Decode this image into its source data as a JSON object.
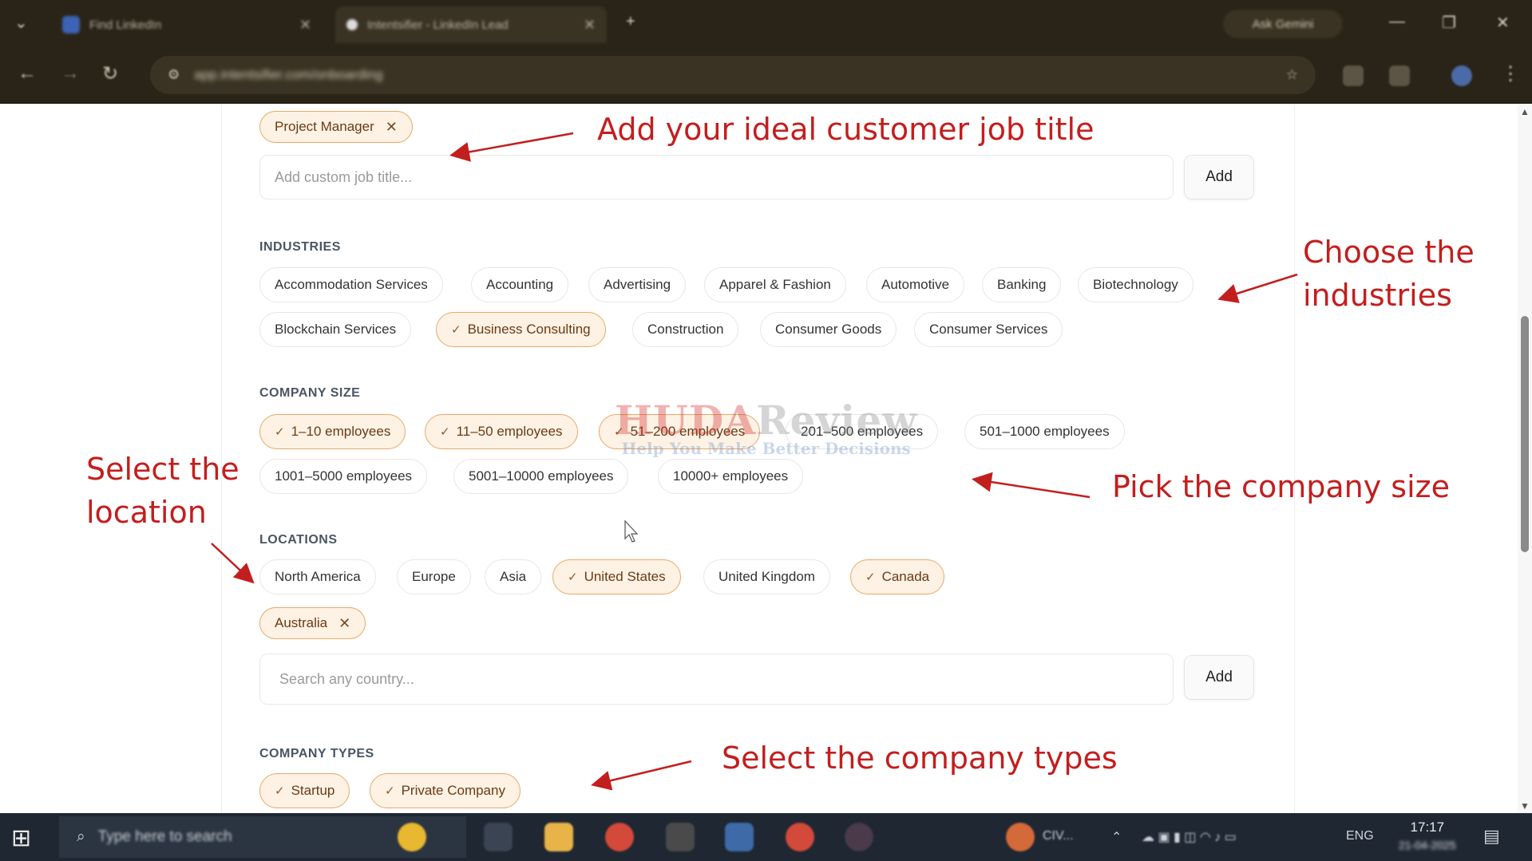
{
  "browser": {
    "tab1_title": "Find LinkedIn",
    "tab2_title": "Intentsifier - LinkedIn Lead",
    "ask_gemini": "Ask Gemini",
    "url": "app.intentsifier.com/onboarding"
  },
  "job_titles": {
    "selected": [
      {
        "label": "Project Manager"
      }
    ],
    "input_placeholder": "Add custom job title...",
    "add_label": "Add"
  },
  "industries": {
    "heading": "INDUSTRIES",
    "options": [
      {
        "label": "Accommodation Services",
        "selected": false
      },
      {
        "label": "Accounting",
        "selected": false
      },
      {
        "label": "Advertising",
        "selected": false
      },
      {
        "label": "Apparel & Fashion",
        "selected": false
      },
      {
        "label": "Automotive",
        "selected": false
      },
      {
        "label": "Banking",
        "selected": false
      },
      {
        "label": "Biotechnology",
        "selected": false
      },
      {
        "label": "Blockchain Services",
        "selected": false
      },
      {
        "label": "Business Consulting",
        "selected": true
      },
      {
        "label": "Construction",
        "selected": false
      },
      {
        "label": "Consumer Goods",
        "selected": false
      },
      {
        "label": "Consumer Services",
        "selected": false
      }
    ]
  },
  "company_size": {
    "heading": "COMPANY SIZE",
    "options": [
      {
        "label": "1–10 employees",
        "selected": true
      },
      {
        "label": "11–50 employees",
        "selected": true
      },
      {
        "label": "51–200 employees",
        "selected": true
      },
      {
        "label": "201–500 employees",
        "selected": false
      },
      {
        "label": "501–1000 employees",
        "selected": false
      },
      {
        "label": "1001–5000 employees",
        "selected": false
      },
      {
        "label": "5001–10000 employees",
        "selected": false
      },
      {
        "label": "10000+ employees",
        "selected": false
      }
    ]
  },
  "locations": {
    "heading": "LOCATIONS",
    "options": [
      {
        "label": "North America",
        "selected": false
      },
      {
        "label": "Europe",
        "selected": false
      },
      {
        "label": "Asia",
        "selected": false
      },
      {
        "label": "United States",
        "selected": true
      },
      {
        "label": "United Kingdom",
        "selected": false
      },
      {
        "label": "Canada",
        "selected": true
      }
    ],
    "custom": [
      {
        "label": "Australia"
      }
    ],
    "input_placeholder": "Search any country...",
    "add_label": "Add"
  },
  "company_types": {
    "heading": "COMPANY TYPES",
    "options": [
      {
        "label": "Startup",
        "selected": true
      },
      {
        "label": "Private Company",
        "selected": true
      }
    ]
  },
  "annotations": {
    "job_title": "Add your ideal customer job title",
    "industries_line1": "Choose the",
    "industries_line2": "industries",
    "company_size": "Pick the company size",
    "location_line1": "Select the",
    "location_line2": "location",
    "company_types": "Select the company types"
  },
  "watermark": {
    "brand_a": "HUDA",
    "brand_b": "Review",
    "tagline": "Help You Make Better Decisions"
  },
  "taskbar": {
    "search_placeholder": "Type here to search",
    "weather": "CIV...",
    "language": "ENG",
    "time": "17:17",
    "date": "21-04-2025"
  },
  "colors": {
    "selected_bg": "#fdf2e4",
    "selected_border": "#e8a868",
    "annotation": "#c31e1e"
  }
}
